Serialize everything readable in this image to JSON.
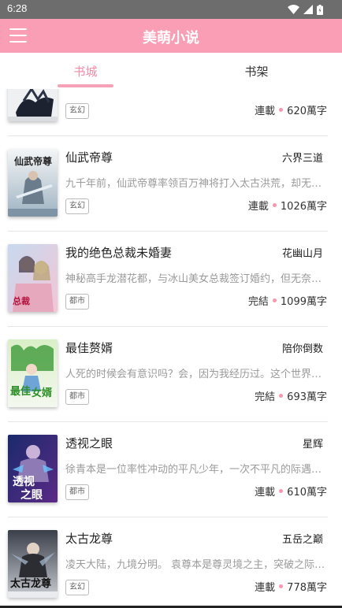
{
  "status_bar": {
    "time": "6:28"
  },
  "app_bar": {
    "title": "美萌小说"
  },
  "tabs": [
    {
      "label": "书城",
      "active": true
    },
    {
      "label": "书架",
      "active": false
    }
  ],
  "colors": {
    "accent": "#f99eb4",
    "tab_active": "#f58aa6",
    "status_dot": "#f597ae"
  },
  "books": [
    {
      "title": "",
      "author": "",
      "description": "",
      "genre": "玄幻",
      "status": "連載",
      "word_count": "620萬字"
    },
    {
      "title": "仙武帝尊",
      "author": "六界三道",
      "description": "九千年前，仙武帝尊率领百万神将打入太古洪荒，却无…",
      "genre": "玄幻",
      "status": "連載",
      "word_count": "1026萬字"
    },
    {
      "title": "我的绝色总裁未婚妻",
      "author": "花幽山月",
      "description": "神秘高手龙潜花都，与冰山美女总裁签订婚约，但无奈…",
      "genre": "都市",
      "status": "完結",
      "word_count": "1099萬字"
    },
    {
      "title": "最佳赘婿",
      "author": "陪你倒数",
      "description": "人死的时候会有意识吗？会，因为我经历过。这个世界…",
      "genre": "都市",
      "status": "完結",
      "word_count": "693萬字"
    },
    {
      "title": "透视之眼",
      "author": "星辉",
      "description": "徐青本是一位率性冲动的平凡少年，一次不平凡的际遇…",
      "genre": "都市",
      "status": "連載",
      "word_count": "610萬字"
    },
    {
      "title": "太古龙尊",
      "author": "五岳之巅",
      "description": "凌天大陆，九境分明。 袁尊本是尊灵境之主，突破之际…",
      "genre": "玄幻",
      "status": "連載",
      "word_count": "778萬字"
    }
  ]
}
